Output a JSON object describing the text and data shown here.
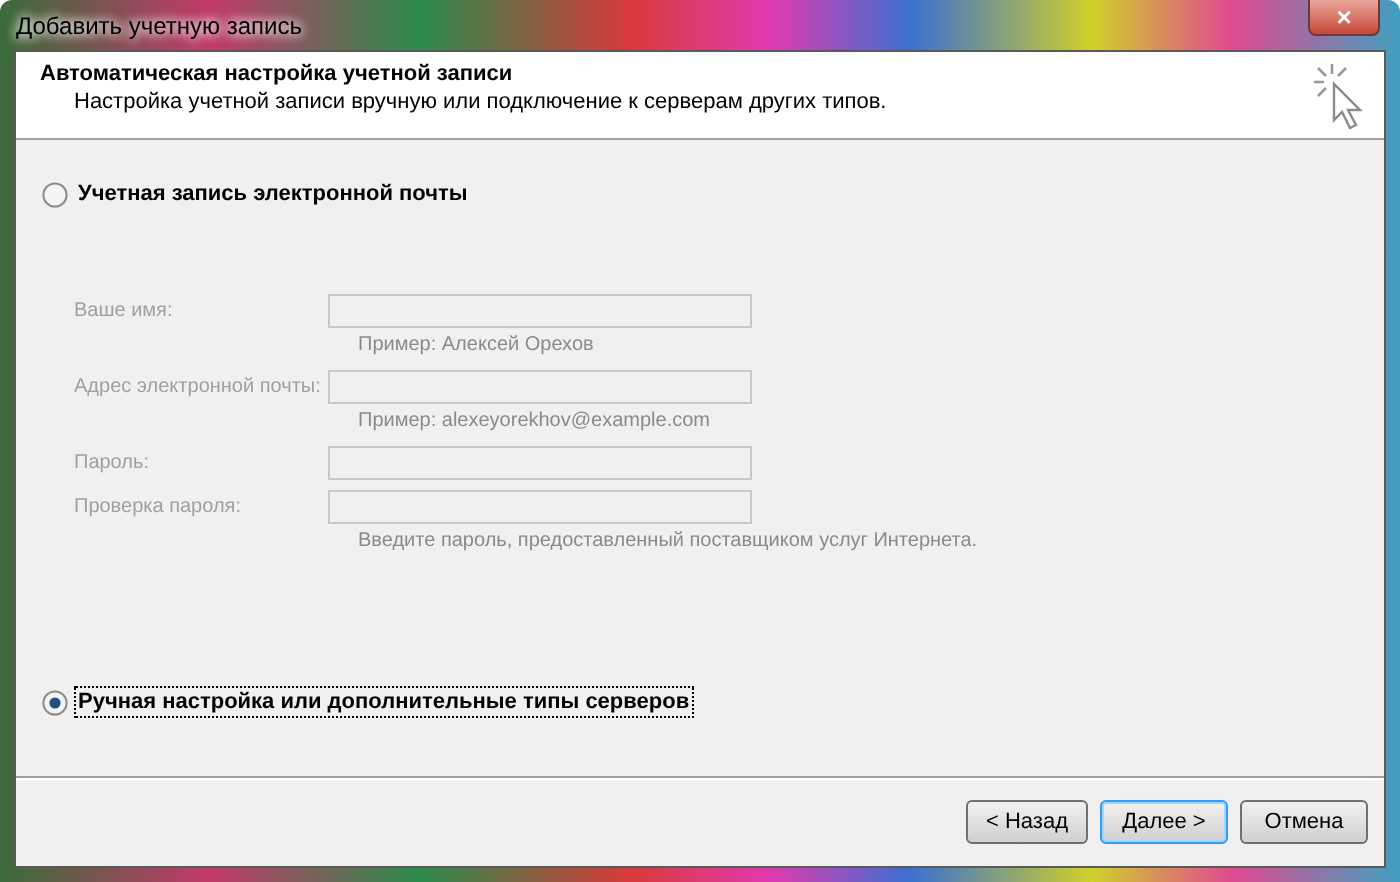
{
  "window": {
    "title": "Добавить учетную запись",
    "close": "×"
  },
  "header": {
    "title": "Автоматическая настройка учетной записи",
    "subtitle": "Настройка учетной записи вручную или подключение к серверам других типов."
  },
  "options": [
    {
      "label": "Учетная запись электронной почты",
      "selected": false
    },
    {
      "label": "Ручная настройка или дополнительные типы серверов",
      "selected": true
    }
  ],
  "fields": [
    {
      "label": "Ваше имя:",
      "disabled": true,
      "hint": "Пример: Алексей Орехов"
    },
    {
      "label": "Адрес электронной почты:",
      "disabled": true,
      "hint": "Пример: alexeyorekhov@example.com"
    },
    {
      "label": "Пароль:",
      "disabled": true
    },
    {
      "label": "Проверка пароля:",
      "disabled": true,
      "hint": "Введите пароль, предоставленный поставщиком услуг Интернета."
    }
  ],
  "buttons": [
    {
      "label": "< Назад",
      "default": false
    },
    {
      "label": "Далее >",
      "default": true
    },
    {
      "label": "Отмена",
      "default": false
    }
  ]
}
